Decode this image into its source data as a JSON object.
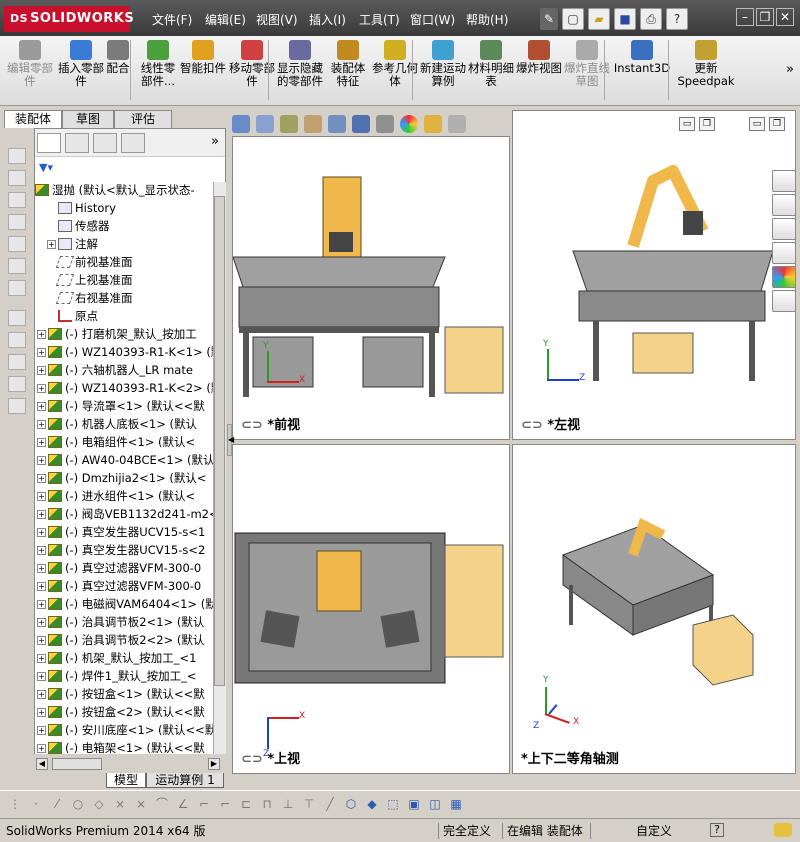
{
  "app": {
    "brand_prefix": "DS",
    "brand": "SOLIDWORKS"
  },
  "menu": [
    "文件(F)",
    "编辑(E)",
    "视图(V)",
    "插入(I)",
    "工具(T)",
    "窗口(W)",
    "帮助(H)"
  ],
  "toolbar": [
    {
      "label": "编辑零部件",
      "disabled": true,
      "color": "#9a9a9a"
    },
    {
      "label": "插入零部件",
      "disabled": false,
      "color": "#3a7bd5"
    },
    {
      "label": "配合",
      "disabled": false,
      "color": "#7a7a7a"
    },
    {
      "label": "线性零部件...",
      "disabled": false,
      "color": "#4aa03a"
    },
    {
      "label": "智能扣件",
      "disabled": false,
      "color": "#e0a020"
    },
    {
      "label": "移动零部件",
      "disabled": false,
      "color": "#d04040"
    },
    {
      "label": "显示隐藏的零部件",
      "disabled": false,
      "color": "#6a6aa0"
    },
    {
      "label": "装配体特征",
      "disabled": false,
      "color": "#c08a20"
    },
    {
      "label": "参考几何体",
      "disabled": false,
      "color": "#d0b020"
    },
    {
      "label": "新建运动算例",
      "disabled": false,
      "color": "#40a0d0"
    },
    {
      "label": "材料明细表",
      "disabled": false,
      "color": "#5a8a5a"
    },
    {
      "label": "爆炸视图",
      "disabled": false,
      "color": "#b05030"
    },
    {
      "label": "爆炸直线草图",
      "disabled": true,
      "color": "#aaaaaa"
    },
    {
      "label": "Instant3D",
      "disabled": false,
      "color": "#3a70c0"
    },
    {
      "label": "更新Speedpak",
      "disabled": false,
      "color": "#c0a030"
    }
  ],
  "left_tabs": [
    "装配体",
    "草图",
    "评估"
  ],
  "tree": {
    "filter_icon": "funnel-icon",
    "root": "湿抛 (默认<默认_显示状态-",
    "items": [
      {
        "text": "History",
        "icon": "history",
        "exp": false,
        "level": 1
      },
      {
        "text": "传感器",
        "icon": "sensor",
        "exp": false,
        "level": 1
      },
      {
        "text": "注解",
        "icon": "annotation",
        "exp": true,
        "level": 1
      },
      {
        "text": "前视基准面",
        "icon": "plane",
        "exp": false,
        "level": 1
      },
      {
        "text": "上视基准面",
        "icon": "plane",
        "exp": false,
        "level": 1
      },
      {
        "text": "右视基准面",
        "icon": "plane",
        "exp": false,
        "level": 1
      },
      {
        "text": "原点",
        "icon": "origin",
        "exp": false,
        "level": 1
      },
      {
        "text": "(-) 打磨机架_默认_按加工",
        "icon": "cube",
        "exp": true,
        "level": 0
      },
      {
        "text": "(-) WZ140393-R1-K<1> (默",
        "icon": "cube",
        "exp": true,
        "level": 0
      },
      {
        "text": "(-) 六轴机器人_LR mate",
        "icon": "cube",
        "exp": true,
        "level": 0
      },
      {
        "text": "(-) WZ140393-R1-K<2> (默",
        "icon": "cube",
        "exp": true,
        "level": 0
      },
      {
        "text": "(-) 导流罩<1> (默认<<默",
        "icon": "cube",
        "exp": true,
        "level": 0
      },
      {
        "text": "(-) 机器人底板<1> (默认",
        "icon": "cube",
        "exp": true,
        "level": 0
      },
      {
        "text": "(-) 电箱组件<1> (默认<",
        "icon": "cube",
        "exp": true,
        "level": 0
      },
      {
        "text": "(-) AW40-04BCE<1> (默认",
        "icon": "cube",
        "exp": true,
        "level": 0
      },
      {
        "text": "(-) Dmzhijia2<1> (默认<",
        "icon": "cube",
        "exp": true,
        "level": 0
      },
      {
        "text": "(-) 进水组件<1> (默认<",
        "icon": "cube",
        "exp": true,
        "level": 0
      },
      {
        "text": "(-) 阀岛VEB1132d241-m2<",
        "icon": "cube",
        "exp": true,
        "level": 0
      },
      {
        "text": "(-) 真空发生器UCV15-s<1",
        "icon": "cube",
        "exp": true,
        "level": 0
      },
      {
        "text": "(-) 真空发生器UCV15-s<2",
        "icon": "cube",
        "exp": true,
        "level": 0
      },
      {
        "text": "(-) 真空过滤器VFM-300-0",
        "icon": "cube",
        "exp": true,
        "level": 0
      },
      {
        "text": "(-) 真空过滤器VFM-300-0",
        "icon": "cube",
        "exp": true,
        "level": 0
      },
      {
        "text": "(-) 电磁阀VAM6404<1> (默",
        "icon": "cube",
        "exp": true,
        "level": 0
      },
      {
        "text": "(-) 治具调节板2<1> (默认",
        "icon": "cube",
        "exp": true,
        "level": 0
      },
      {
        "text": "(-) 治具调节板2<2> (默认",
        "icon": "cube",
        "exp": true,
        "level": 0
      },
      {
        "text": "(-) 机架_默认_按加工_<1",
        "icon": "cube",
        "exp": true,
        "level": 0
      },
      {
        "text": "(-) 焊件1_默认_按加工_<",
        "icon": "cube",
        "exp": true,
        "level": 0
      },
      {
        "text": "(-) 按钮盒<1> (默认<<默",
        "icon": "cube",
        "exp": true,
        "level": 0
      },
      {
        "text": "(-) 按钮盒<2> (默认<<默",
        "icon": "cube",
        "exp": true,
        "level": 0
      },
      {
        "text": "(-) 安川底座<1> (默认<<默",
        "icon": "cube",
        "exp": true,
        "level": 0
      },
      {
        "text": "(-) 电箱架<1> (默认<<默",
        "icon": "cube",
        "exp": true,
        "level": 0
      }
    ]
  },
  "bottom_tabs": [
    "模型",
    "运动算例 1"
  ],
  "viewports": [
    {
      "label": "*前视"
    },
    {
      "label": "*左视"
    },
    {
      "label": "*上视"
    },
    {
      "label": "*上下二等角轴测"
    }
  ],
  "axes": {
    "x": "X",
    "y": "Y",
    "z": "Z"
  },
  "status": {
    "product": "SolidWorks Premium 2014 x64 版",
    "defined": "完全定义",
    "mode": "在编辑 装配体",
    "units": "自定义",
    "help": "?"
  },
  "colors": {
    "accent": "#c8102e",
    "robot": "#f0b84a",
    "frame": "#8a8a8a",
    "box": "#f5d28a"
  }
}
